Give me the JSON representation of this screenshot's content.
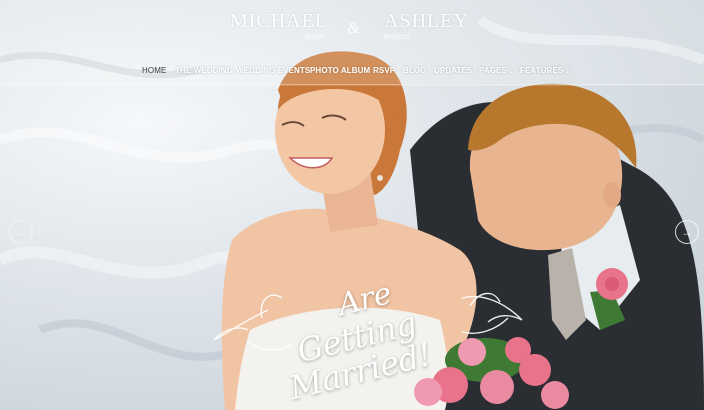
{
  "couple": {
    "groom_first": "MICHAEL",
    "groom_last": "Smith",
    "ampersand": "&",
    "bride_first": "ASHLEY",
    "bride_last": "Bellucci"
  },
  "nav": {
    "items": [
      {
        "label": "HOME",
        "active": true
      },
      {
        "label": "THE WEDDING"
      },
      {
        "label": "WEDDING EVENTS"
      },
      {
        "label": "PHOTO ALBUM"
      },
      {
        "label": "RSVP"
      },
      {
        "label": "BLOG"
      },
      {
        "label": "UPDATES"
      },
      {
        "label": "PAGES ↓"
      },
      {
        "label": "FEATURES ↓"
      }
    ]
  },
  "hero": {
    "line1": "Are",
    "line2": "Getting",
    "line3": "Married!"
  },
  "slider": {
    "prev_icon": "arrow-left-icon",
    "next_icon": "arrow-right-icon",
    "prev_glyph": "←",
    "next_glyph": "→"
  },
  "colors": {
    "suit": "#2a2d32",
    "hair_groom": "#b7782e",
    "hair_bride": "#c9783a",
    "skin": "#f1c4a3",
    "rose": "#e9738a"
  }
}
